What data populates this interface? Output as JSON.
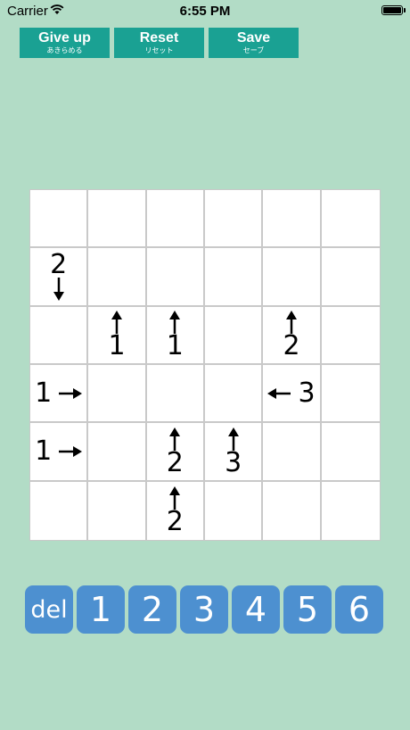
{
  "status_bar": {
    "carrier": "Carrier",
    "time": "6:55 PM"
  },
  "toolbar": {
    "give_up": {
      "label": "Give up",
      "sub": "あきらめる"
    },
    "reset": {
      "label": "Reset",
      "sub": "リセット"
    },
    "save": {
      "label": "Save",
      "sub": "セーブ"
    }
  },
  "board": {
    "rows": 6,
    "cols": 6,
    "clues": [
      {
        "row": 1,
        "col": 0,
        "number": "2",
        "direction": "down"
      },
      {
        "row": 2,
        "col": 1,
        "number": "1",
        "direction": "up"
      },
      {
        "row": 2,
        "col": 2,
        "number": "1",
        "direction": "up"
      },
      {
        "row": 2,
        "col": 4,
        "number": "2",
        "direction": "up"
      },
      {
        "row": 3,
        "col": 0,
        "number": "1",
        "direction": "right"
      },
      {
        "row": 3,
        "col": 4,
        "number": "3",
        "direction": "left"
      },
      {
        "row": 4,
        "col": 0,
        "number": "1",
        "direction": "right"
      },
      {
        "row": 4,
        "col": 2,
        "number": "2",
        "direction": "up"
      },
      {
        "row": 4,
        "col": 3,
        "number": "3",
        "direction": "up"
      },
      {
        "row": 5,
        "col": 2,
        "number": "2",
        "direction": "up"
      }
    ]
  },
  "numpad": {
    "keys": [
      "del",
      "1",
      "2",
      "3",
      "4",
      "5",
      "6"
    ]
  },
  "colors": {
    "background": "#b2dcc6",
    "toolbar_button": "#1aa193",
    "numpad_key": "#4d90d0",
    "grid_line": "#c9c9c9"
  }
}
